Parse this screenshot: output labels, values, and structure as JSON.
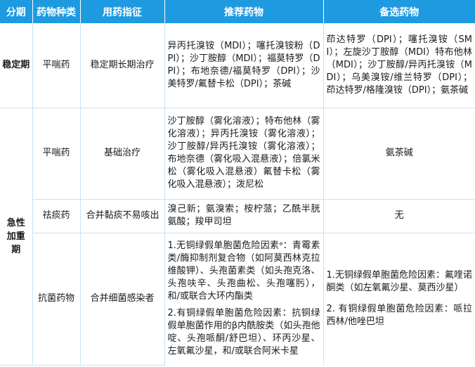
{
  "headers": [
    "分期",
    "药物种类",
    "用药指征",
    "推荐药物",
    "备选药物"
  ],
  "stable": {
    "phase": "稳定期",
    "drug_class": "平喘药",
    "indication": "稳定期长期治疗",
    "recommended": "异丙托溴铵（MDI）；噻托溴铵粉（DPI）；沙丁胺醇（MDI）；福莫特罗（DPI）；布地奈德/福莫特罗（DPI）；沙美特罗/氟替卡松（DPI）；茶碱",
    "alternative": "茚达特罗（DPI）；噻托溴铵（SMI）；左旋沙丁胺醇（MDI）特布他林（MDI）；沙丁胺醇/异丙托溴铵（MDI）；乌美溴铵/维兰特罗（DPI）；茚达特罗/格隆溴铵（DPI）；氨茶碱"
  },
  "acute": {
    "phase": "急性加重期",
    "rows": [
      {
        "drug_class": "平喘药",
        "indication": "基础治疗",
        "recommended": "沙丁胺醇（雾化溶液）；特布他林（雾化溶液）；异丙托溴铵（雾化溶液）；沙丁胺醇/异丙托溴铵（雾化溶液）；布地奈德（雾化吸入混悬液）；倍氯米松（雾化吸入混悬液）氟替卡松（雾化吸入混悬液）；泼尼松",
        "alternative": "氨茶碱"
      },
      {
        "drug_class": "祛痰药",
        "indication": "合并黏痰不易咳出",
        "recommended": "溴己新；氨溴索；桉柠蒎；乙酰半胱氨酸；羧甲司坦",
        "alternative": "无"
      },
      {
        "drug_class": "抗菌药物",
        "indication": "合并细菌感染者",
        "recommended_1": "1.无铜绿假单胞菌危险因素ᵃ：青霉素类/酶抑制剂复合物（如阿莫西林克拉维酸钾）、头孢菌素类（如头孢克洛、头孢呋辛、头孢曲松、头孢噻肟），和/或联合大环内酯类",
        "recommended_2": "2.有铜绿假单胞菌危险因素：抗铜绿假单胞菌作用的β内酰胺类（如头孢他啶、头孢哌酮/舒巴坦）、环丙沙星、左氧氟沙星，和/或联合阿米卡星",
        "alternative_1": "1.无铜绿假单胞菌危险因素：氟喹诺酮类（如左氧氟沙星、莫西沙星）",
        "alternative_2": "2. 有铜绿假单胞菌危险因素：哌拉西林/他唑巴坦"
      }
    ]
  }
}
